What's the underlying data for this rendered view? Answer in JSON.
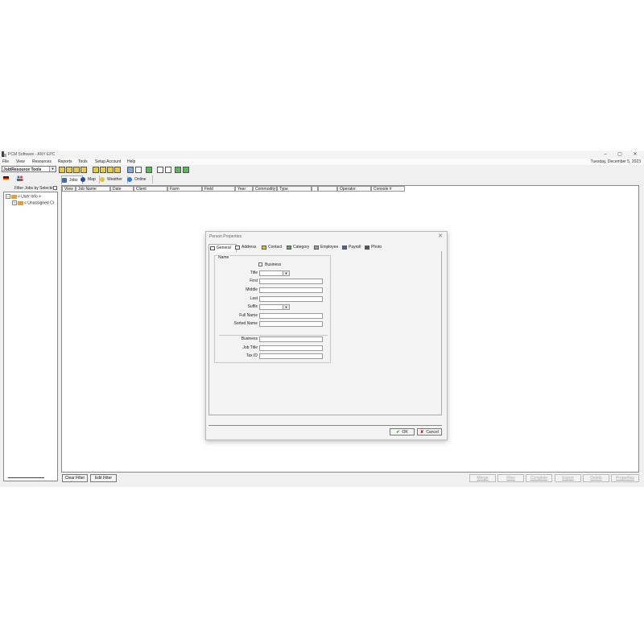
{
  "app": {
    "title": "PCM Software - ANY EPC",
    "date": "Tuesday, December 5, 2023",
    "window_controls": {
      "minimize": "–",
      "maximize": "▢",
      "close": "✕"
    }
  },
  "menu": [
    "File",
    "View",
    "Resources",
    "Reports",
    "Tools",
    "Setup Account",
    "Help"
  ],
  "toolbar": {
    "combo_value": "Job/Resource Tools",
    "icons": [
      "tool-1-icon",
      "tool-2-icon",
      "tool-3-icon",
      "tool-4-icon",
      "tool-5-icon",
      "tool-6-icon",
      "tool-7-icon",
      "tool-8-icon",
      "tool-9-icon",
      "tool-10-icon",
      "tool-11-icon",
      "tool-12-icon"
    ]
  },
  "left_panel": {
    "filter_label": "Filter Jobs by Selection",
    "tree": [
      {
        "expander": "–",
        "label": "< User Info >"
      },
      {
        "expander": "+",
        "label": "< Unassigned Cl"
      }
    ]
  },
  "main_tabs": [
    {
      "label": "Jobs",
      "icon": "jobs-icon",
      "color": "#3b6fb6"
    },
    {
      "label": "Map",
      "icon": "map-icon",
      "color": "#1f4e9a"
    },
    {
      "label": "Weather",
      "icon": "weather-icon",
      "color": "#e5c13a"
    },
    {
      "label": "Online",
      "icon": "online-icon",
      "color": "#2a7fd4"
    }
  ],
  "grid": {
    "columns": [
      "View",
      "Job Name",
      "Date",
      "Client",
      "Farm",
      "Field",
      "Year",
      "Commodity",
      "Type",
      "",
      "",
      "Operator",
      "Console #",
      ""
    ]
  },
  "bottom_buttons": {
    "left": [
      "Clear Filter",
      "Edit Filter"
    ],
    "right": [
      "Merge",
      "Files",
      "Complete",
      "Export",
      "Delete",
      "Properties"
    ]
  },
  "dialog": {
    "title": "Person Properties",
    "close": "✕",
    "tabs": [
      "General",
      "Address",
      "Contact",
      "Category",
      "Employee",
      "Payroll",
      "Photo"
    ],
    "active_tab": "General",
    "group_label": "Name",
    "business_checkbox_label": "Business",
    "fields": {
      "title": "Title",
      "first": "First",
      "middle": "Middle",
      "last": "Last",
      "suffix": "Suffix",
      "full_name": "Full Name",
      "sorted_name": "Sorted Name",
      "business": "Business",
      "job_title": "Job Title",
      "tax_id": "Tax ID"
    },
    "ok_label": "OK",
    "cancel_label": "Cancel"
  }
}
